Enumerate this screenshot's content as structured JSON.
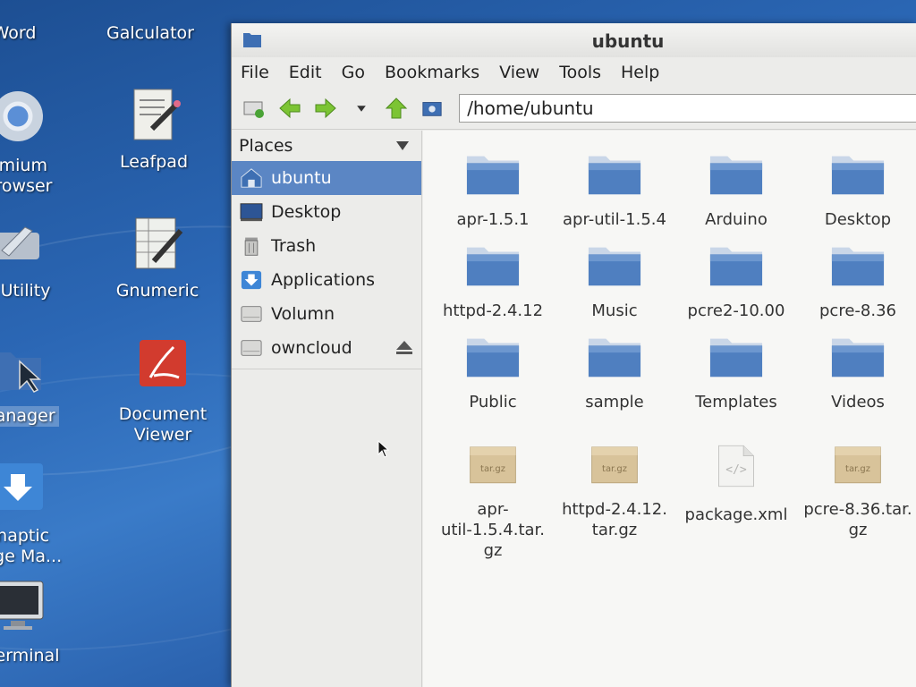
{
  "desktop": {
    "icons": [
      {
        "label": "Word",
        "icon": "document-icon"
      },
      {
        "label": "Galculator",
        "icon": "calculator-icon"
      },
      {
        "label": "omium\nBrowser",
        "icon": "chromium-icon"
      },
      {
        "label": "Leafpad",
        "icon": "leafpad-icon"
      },
      {
        "label": "k Utility",
        "icon": "wrench-icon"
      },
      {
        "label": "Gnumeric",
        "icon": "spreadsheet-icon"
      },
      {
        "label": "Manager",
        "icon": "file-manager-icon"
      },
      {
        "label": "Document\nViewer",
        "icon": "document-viewer-icon"
      },
      {
        "label": "ynaptic\nkage Ma...",
        "icon": "synaptic-icon"
      },
      {
        "label": "XTerminal",
        "icon": "terminal-icon"
      }
    ]
  },
  "window": {
    "title": "ubuntu",
    "menu": [
      "File",
      "Edit",
      "Go",
      "Bookmarks",
      "View",
      "Tools",
      "Help"
    ],
    "address": "/home/ubuntu",
    "sidebar": {
      "header": "Places",
      "items": [
        {
          "label": "ubuntu",
          "icon": "home-icon",
          "active": true
        },
        {
          "label": "Desktop",
          "icon": "desktop-icon"
        },
        {
          "label": "Trash",
          "icon": "trash-icon"
        },
        {
          "label": "Applications",
          "icon": "applications-icon"
        },
        {
          "label": "Volumn",
          "icon": "drive-icon"
        },
        {
          "label": "owncloud",
          "icon": "drive-icon"
        }
      ]
    },
    "files": [
      {
        "label": "apr-1.5.1",
        "type": "folder"
      },
      {
        "label": "apr-util-1.5.4",
        "type": "folder"
      },
      {
        "label": "Arduino",
        "type": "folder"
      },
      {
        "label": "Desktop",
        "type": "folder"
      },
      {
        "label": "httpd-2.4.12",
        "type": "folder"
      },
      {
        "label": "Music",
        "type": "folder"
      },
      {
        "label": "pcre2-10.00",
        "type": "folder"
      },
      {
        "label": "pcre-8.36",
        "type": "folder"
      },
      {
        "label": "Public",
        "type": "folder"
      },
      {
        "label": "sample",
        "type": "folder"
      },
      {
        "label": "Templates",
        "type": "folder"
      },
      {
        "label": "Videos",
        "type": "folder"
      },
      {
        "label": "apr-\nutil-1.5.4.tar.\ngz",
        "type": "archive",
        "badge": "tar.gz"
      },
      {
        "label": "httpd-2.4.12.\ntar.gz",
        "type": "archive",
        "badge": "tar.gz"
      },
      {
        "label": "package.xml",
        "type": "xml"
      },
      {
        "label": "pcre-8.36.tar.\ngz",
        "type": "archive",
        "badge": "tar.gz"
      }
    ]
  },
  "colors": {
    "selection": "#5b86c4",
    "folder": "#4f7fc0",
    "archive": "#d8c39a"
  }
}
